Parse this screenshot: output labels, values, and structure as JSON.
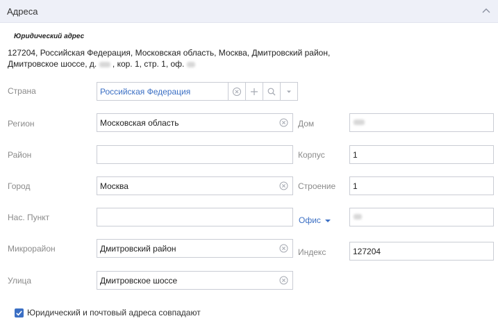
{
  "section": {
    "title": "Адреса"
  },
  "legal": {
    "subtitle": "Юридический адрес",
    "line1": "127204, Российская Федерация, Московская область, Москва, Дмитровский район,",
    "line2_pre": "Дмитровское шоссе, д.",
    "line2_mid": ", кор. 1, стр. 1, оф."
  },
  "labels": {
    "country": "Страна",
    "region": "Регион",
    "district": "Район",
    "city": "Город",
    "settlement": "Нас. Пункт",
    "microdistrict": "Микрорайон",
    "street": "Улица",
    "house": "Дом",
    "building": "Корпус",
    "structure": "Строение",
    "office": "Офис",
    "index": "Индекс"
  },
  "values": {
    "country": "Российская Федерация",
    "region": "Московская область",
    "district": "",
    "city": "Москва",
    "settlement": "",
    "microdistrict": "Дмитровский район",
    "street": "Дмитровское шоссе",
    "building": "1",
    "structure": "1",
    "index": "127204"
  },
  "checkbox": {
    "label": "Юридический и почтовый адреса совпадают",
    "checked": true
  },
  "colors": {
    "accent": "#3b6fc4",
    "header_bg": "#eef0f8",
    "border": "#c9ccd4",
    "label": "#8a8a8a"
  },
  "icons": [
    "chevron-up-icon",
    "clear-icon",
    "plus-icon",
    "search-icon",
    "dropdown-arrow-icon",
    "checkmark-icon"
  ]
}
